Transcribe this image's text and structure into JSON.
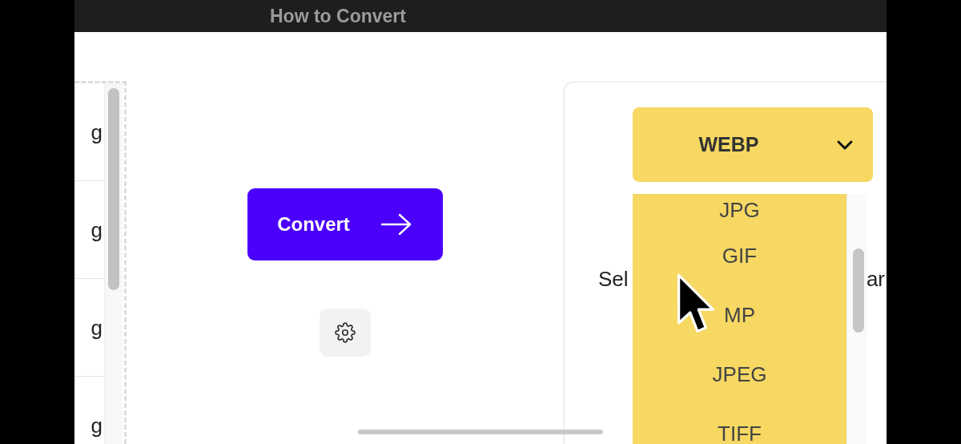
{
  "window": {
    "title": "How to Convert"
  },
  "file_list": {
    "items": [
      {
        "name": "g"
      },
      {
        "name": "g"
      },
      {
        "name": "g"
      },
      {
        "name": "g"
      }
    ]
  },
  "convert_button": {
    "label": "Convert"
  },
  "format_select": {
    "value": "WEBP",
    "expanded": true,
    "options": [
      {
        "label": "JPG"
      },
      {
        "label": "GIF"
      },
      {
        "label": "MP"
      },
      {
        "label": "JPEG"
      },
      {
        "label": "TIFF"
      }
    ]
  },
  "hint": {
    "start": "Sel",
    "end": "ar"
  }
}
